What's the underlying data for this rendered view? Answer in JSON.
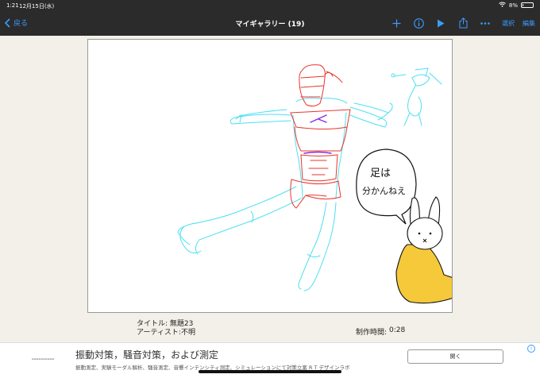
{
  "status": {
    "time": "1:21",
    "date": "12月15日(水)",
    "battery": "8%",
    "battery_level": 0.08
  },
  "nav": {
    "back_label": "戻る",
    "title": "マイギャラリー (19)",
    "select_label": "選択",
    "edit_label": "編集",
    "icons": [
      "plus-icon",
      "info-icon",
      "play-icon",
      "share-icon",
      "more-icon"
    ]
  },
  "artwork": {
    "bubble_text_line1": "足は",
    "bubble_text_line2": "分かんねえ"
  },
  "info": {
    "title": "タイトル: 無題23",
    "artist": "アーティスト:不明",
    "time_label": "制作時間:",
    "time_value": "0:28"
  },
  "ad": {
    "title": "振動対策，騒音対策，および測定",
    "subtitle": "振動測定、実験モーダル解析、騒音測定、音響インテンシティ測定、シミュレーションにて対策立案 R T デザインラボ",
    "open_label": "開く"
  },
  "colors": {
    "accent": "#3b9cff",
    "bar": "#2b2b2b",
    "background": "#f2f0e8",
    "sketch_cyan": "#4de0f0",
    "sketch_red": "#e8352a",
    "sketch_purple": "#8a2be2",
    "yellow": "#f5c93a"
  }
}
